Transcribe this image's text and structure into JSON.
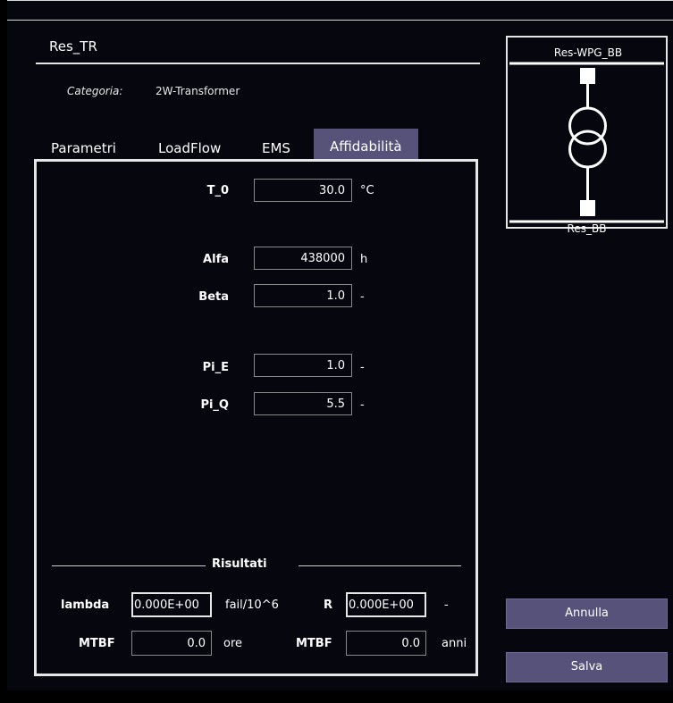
{
  "element": {
    "name": "Res_TR",
    "category_key": "Categoria:",
    "category_value": "2W-Transformer"
  },
  "tabs": [
    {
      "label": "Parametri",
      "active": false
    },
    {
      "label": "LoadFlow",
      "active": false
    },
    {
      "label": "EMS",
      "active": false
    },
    {
      "label": "Affidabilità",
      "active": true
    }
  ],
  "params": {
    "t0": {
      "label": "T_0",
      "value": "30.0",
      "unit": "°C"
    },
    "alfa": {
      "label": "Alfa",
      "value": "438000",
      "unit": "h"
    },
    "beta": {
      "label": "Beta",
      "value": "1.0",
      "unit": "-"
    },
    "pi_e": {
      "label": "Pi_E",
      "value": "1.0",
      "unit": "-"
    },
    "pi_q": {
      "label": "Pi_Q",
      "value": "5.5",
      "unit": "-"
    }
  },
  "results": {
    "title": "Risultati",
    "lambda": {
      "label": "lambda",
      "value": "0.000E+00",
      "unit": "fail/10^6"
    },
    "r": {
      "label": "R",
      "value": "0.000E+00",
      "unit": "-"
    },
    "mtbf_hours": {
      "label": "MTBF",
      "value": "0.0",
      "unit": "ore"
    },
    "mtbf_years": {
      "label": "MTBF",
      "value": "0.0",
      "unit": "anni"
    }
  },
  "diagram": {
    "top_bus": "Res-WPG_BB",
    "bottom_bus": "Res_BB",
    "icon": "two-winding-transformer-icon"
  },
  "buttons": {
    "cancel": "Annulla",
    "save": "Salva"
  },
  "colors": {
    "background": "#06060f",
    "accent": "#56527a",
    "border": "#e6e6e6"
  }
}
